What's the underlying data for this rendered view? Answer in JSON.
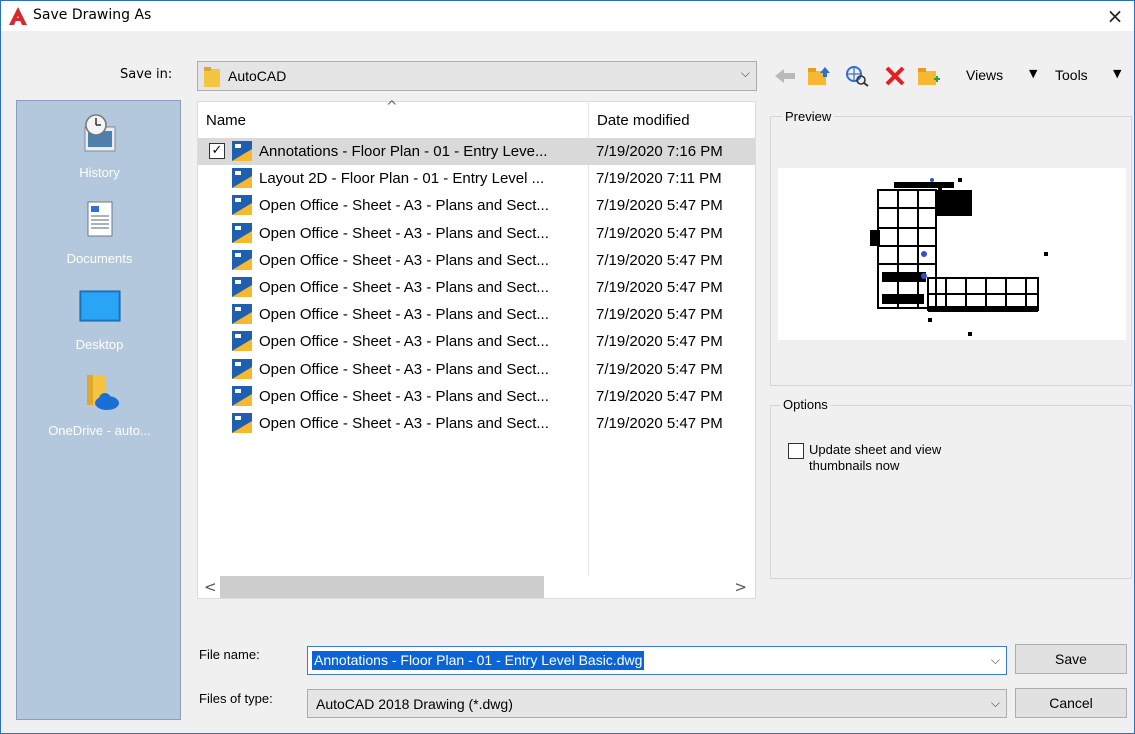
{
  "window": {
    "title": "Save Drawing As",
    "close_glyph": "×"
  },
  "save_in": {
    "label": "Save in:",
    "value": "AutoCAD"
  },
  "toolbar": {
    "views_label": "Views",
    "tools_label": "Tools",
    "icons": [
      "back-arrow-icon",
      "up-folder-icon",
      "search-web-icon",
      "delete-icon",
      "new-folder-icon"
    ]
  },
  "places": [
    {
      "label": "History",
      "icon": "history-icon"
    },
    {
      "label": "Documents",
      "icon": "documents-icon"
    },
    {
      "label": "Desktop",
      "icon": "desktop-icon"
    },
    {
      "label": "OneDrive - auto...",
      "icon": "onedrive-icon"
    }
  ],
  "file_list": {
    "columns": [
      "Name",
      "Date modified"
    ],
    "rows": [
      {
        "name": "Annotations - Floor Plan - 01 - Entry Leve...",
        "date": "7/19/2020 7:16 PM",
        "selected": true,
        "checked": true
      },
      {
        "name": "Layout 2D - Floor Plan - 01 - Entry Level ...",
        "date": "7/19/2020 7:11 PM"
      },
      {
        "name": "Open Office - Sheet - A3 - Plans and Sect...",
        "date": "7/19/2020 5:47 PM"
      },
      {
        "name": "Open Office - Sheet - A3 - Plans and Sect...",
        "date": "7/19/2020 5:47 PM"
      },
      {
        "name": "Open Office - Sheet - A3 - Plans and Sect...",
        "date": "7/19/2020 5:47 PM"
      },
      {
        "name": "Open Office - Sheet - A3 - Plans and Sect...",
        "date": "7/19/2020 5:47 PM"
      },
      {
        "name": "Open Office - Sheet - A3 - Plans and Sect...",
        "date": "7/19/2020 5:47 PM"
      },
      {
        "name": "Open Office - Sheet - A3 - Plans and Sect...",
        "date": "7/19/2020 5:47 PM"
      },
      {
        "name": "Open Office - Sheet - A3 - Plans and Sect...",
        "date": "7/19/2020 5:47 PM"
      },
      {
        "name": "Open Office - Sheet - A3 - Plans and Sect...",
        "date": "7/19/2020 5:47 PM"
      },
      {
        "name": "Open Office - Sheet - A3 - Plans and Sect...",
        "date": "7/19/2020 5:47 PM"
      }
    ]
  },
  "preview": {
    "label": "Preview"
  },
  "options": {
    "label": "Options",
    "checkbox_label_line1": "Update sheet and view",
    "checkbox_label_line2": "thumbnails now",
    "checked": false
  },
  "file_name": {
    "label": "File name:",
    "value": "Annotations - Floor Plan - 01 - Entry Level Basic.dwg"
  },
  "files_of_type": {
    "label": "Files of type:",
    "value": "AutoCAD 2018 Drawing (*.dwg)"
  },
  "buttons": {
    "save": "Save",
    "cancel": "Cancel"
  },
  "colors": {
    "accent": "#0a64d6",
    "places_bg": "#b3c8dc",
    "dialog_bg": "#f0f0f0",
    "autocad_red": "#d42b2b"
  }
}
